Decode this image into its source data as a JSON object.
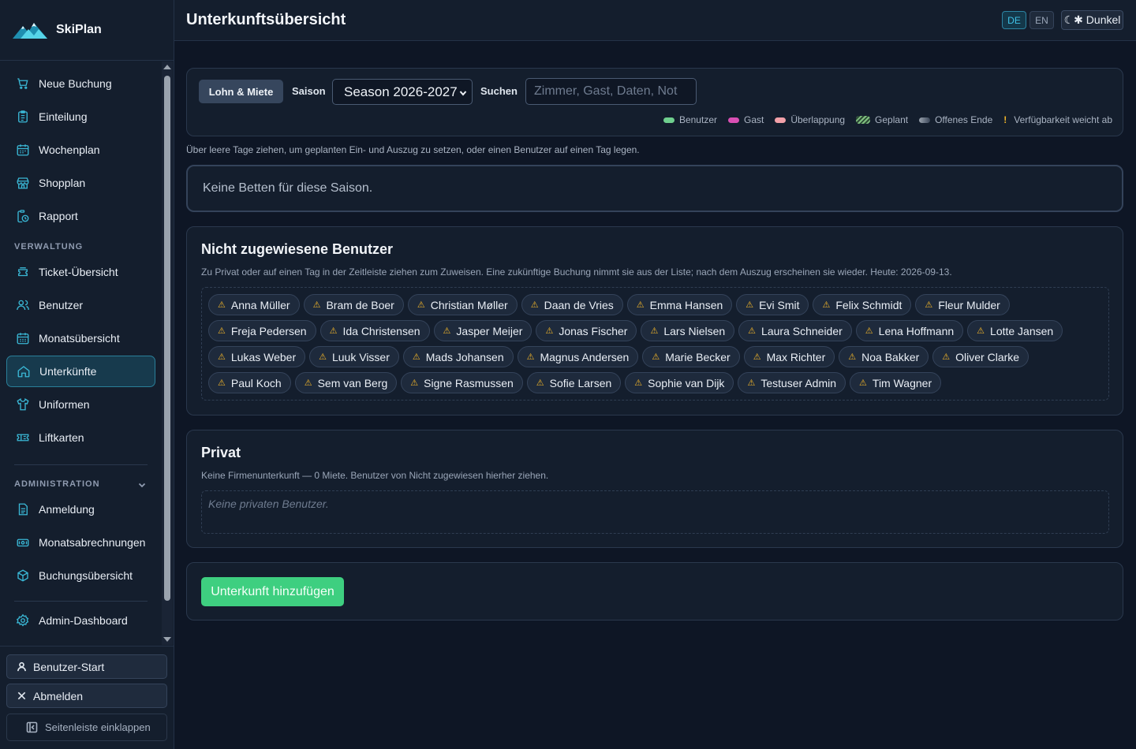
{
  "app": {
    "name": "SkiPlan"
  },
  "header": {
    "title": "Unterkunftsübersicht",
    "lang_de": "DE",
    "lang_en": "EN",
    "active_lang": "DE",
    "theme_label": "☾✱ Dunkel"
  },
  "sidebar": {
    "items": [
      {
        "label": "Neue Buchung",
        "icon": "cart-icon"
      },
      {
        "label": "Einteilung",
        "icon": "clipboard-icon"
      },
      {
        "label": "Wochenplan",
        "icon": "calendar-icon"
      },
      {
        "label": "Shopplan",
        "icon": "store-icon"
      },
      {
        "label": "Rapport",
        "icon": "report-clock-icon"
      }
    ],
    "section_verwaltung": "VERWALTUNG",
    "verwaltung_items": [
      {
        "label": "Ticket-Übersicht",
        "icon": "ticket-stack-icon"
      },
      {
        "label": "Benutzer",
        "icon": "users-icon"
      },
      {
        "label": "Monatsübersicht",
        "icon": "calendar-grid-icon"
      },
      {
        "label": "Unterkünfte",
        "icon": "home-icon",
        "active": true
      },
      {
        "label": "Uniformen",
        "icon": "shirt-icon"
      },
      {
        "label": "Liftkarten",
        "icon": "ticket-icon"
      }
    ],
    "section_administration": "ADMINISTRATION",
    "admin_items": [
      {
        "label": "Anmeldung",
        "icon": "document-icon"
      },
      {
        "label": "Monatsabrechnungen",
        "icon": "money-icon"
      },
      {
        "label": "Buchungsübersicht",
        "icon": "box-icon"
      }
    ],
    "dashboard": {
      "label": "Admin-Dashboard",
      "icon": "gear-icon"
    },
    "footer": {
      "user_start": "Benutzer-Start",
      "logout": "Abmelden",
      "collapse": "Seitenleiste einklappen"
    }
  },
  "toolbar": {
    "pay_button": "Lohn & Miete",
    "season_label": "Saison",
    "season_value": "Season 2026-2027",
    "search_label": "Suchen",
    "search_placeholder": "Zimmer, Gast, Daten, Not",
    "legend": [
      {
        "label": "Benutzer",
        "color": "#6fcf8e"
      },
      {
        "label": "Gast",
        "color": "#d94fb3"
      },
      {
        "label": "Überlappung",
        "color": "#f2a0a8"
      },
      {
        "label": "Geplant",
        "color": "#7fbf7f"
      },
      {
        "label": "Offenes Ende",
        "color": "#6b7788"
      },
      {
        "label": "Verfügbarkeit weicht ab",
        "color": "#f0b429"
      }
    ]
  },
  "hint": "Über leere Tage ziehen, um geplanten Ein- und Auszug zu setzen, oder einen Benutzer auf einen Tag legen.",
  "empty_beds": "Keine Betten für diese Saison.",
  "unassigned": {
    "title": "Nicht zugewiesene Benutzer",
    "description": "Zu Privat oder auf einen Tag in der Zeitleiste ziehen zum Zuweisen. Eine zukünftige Buchung nimmt sie aus der Liste; nach dem Auszug erscheinen sie wieder. Heute: 2026-09-13.",
    "warn_icon": "⚠",
    "users": [
      "Anna Müller",
      "Bram de Boer",
      "Christian Møller",
      "Daan de Vries",
      "Emma Hansen",
      "Evi Smit",
      "Felix Schmidt",
      "Fleur Mulder",
      "Freja Pedersen",
      "Ida Christensen",
      "Jasper Meijer",
      "Jonas Fischer",
      "Lars Nielsen",
      "Laura Schneider",
      "Lena Hoffmann",
      "Lotte Jansen",
      "Lukas Weber",
      "Luuk Visser",
      "Mads Johansen",
      "Magnus Andersen",
      "Marie Becker",
      "Max Richter",
      "Noa Bakker",
      "Oliver Clarke",
      "Paul Koch",
      "Sem van Berg",
      "Signe Rasmussen",
      "Sofie Larsen",
      "Sophie van Dijk",
      "Testuser Admin",
      "Tim Wagner"
    ]
  },
  "private": {
    "title": "Privat",
    "description": "Keine Firmenunterkunft — 0 Miete. Benutzer von Nicht zugewiesen hierher ziehen.",
    "empty": "Keine privaten Benutzer."
  },
  "add_button": "Unterkunft hinzufügen"
}
